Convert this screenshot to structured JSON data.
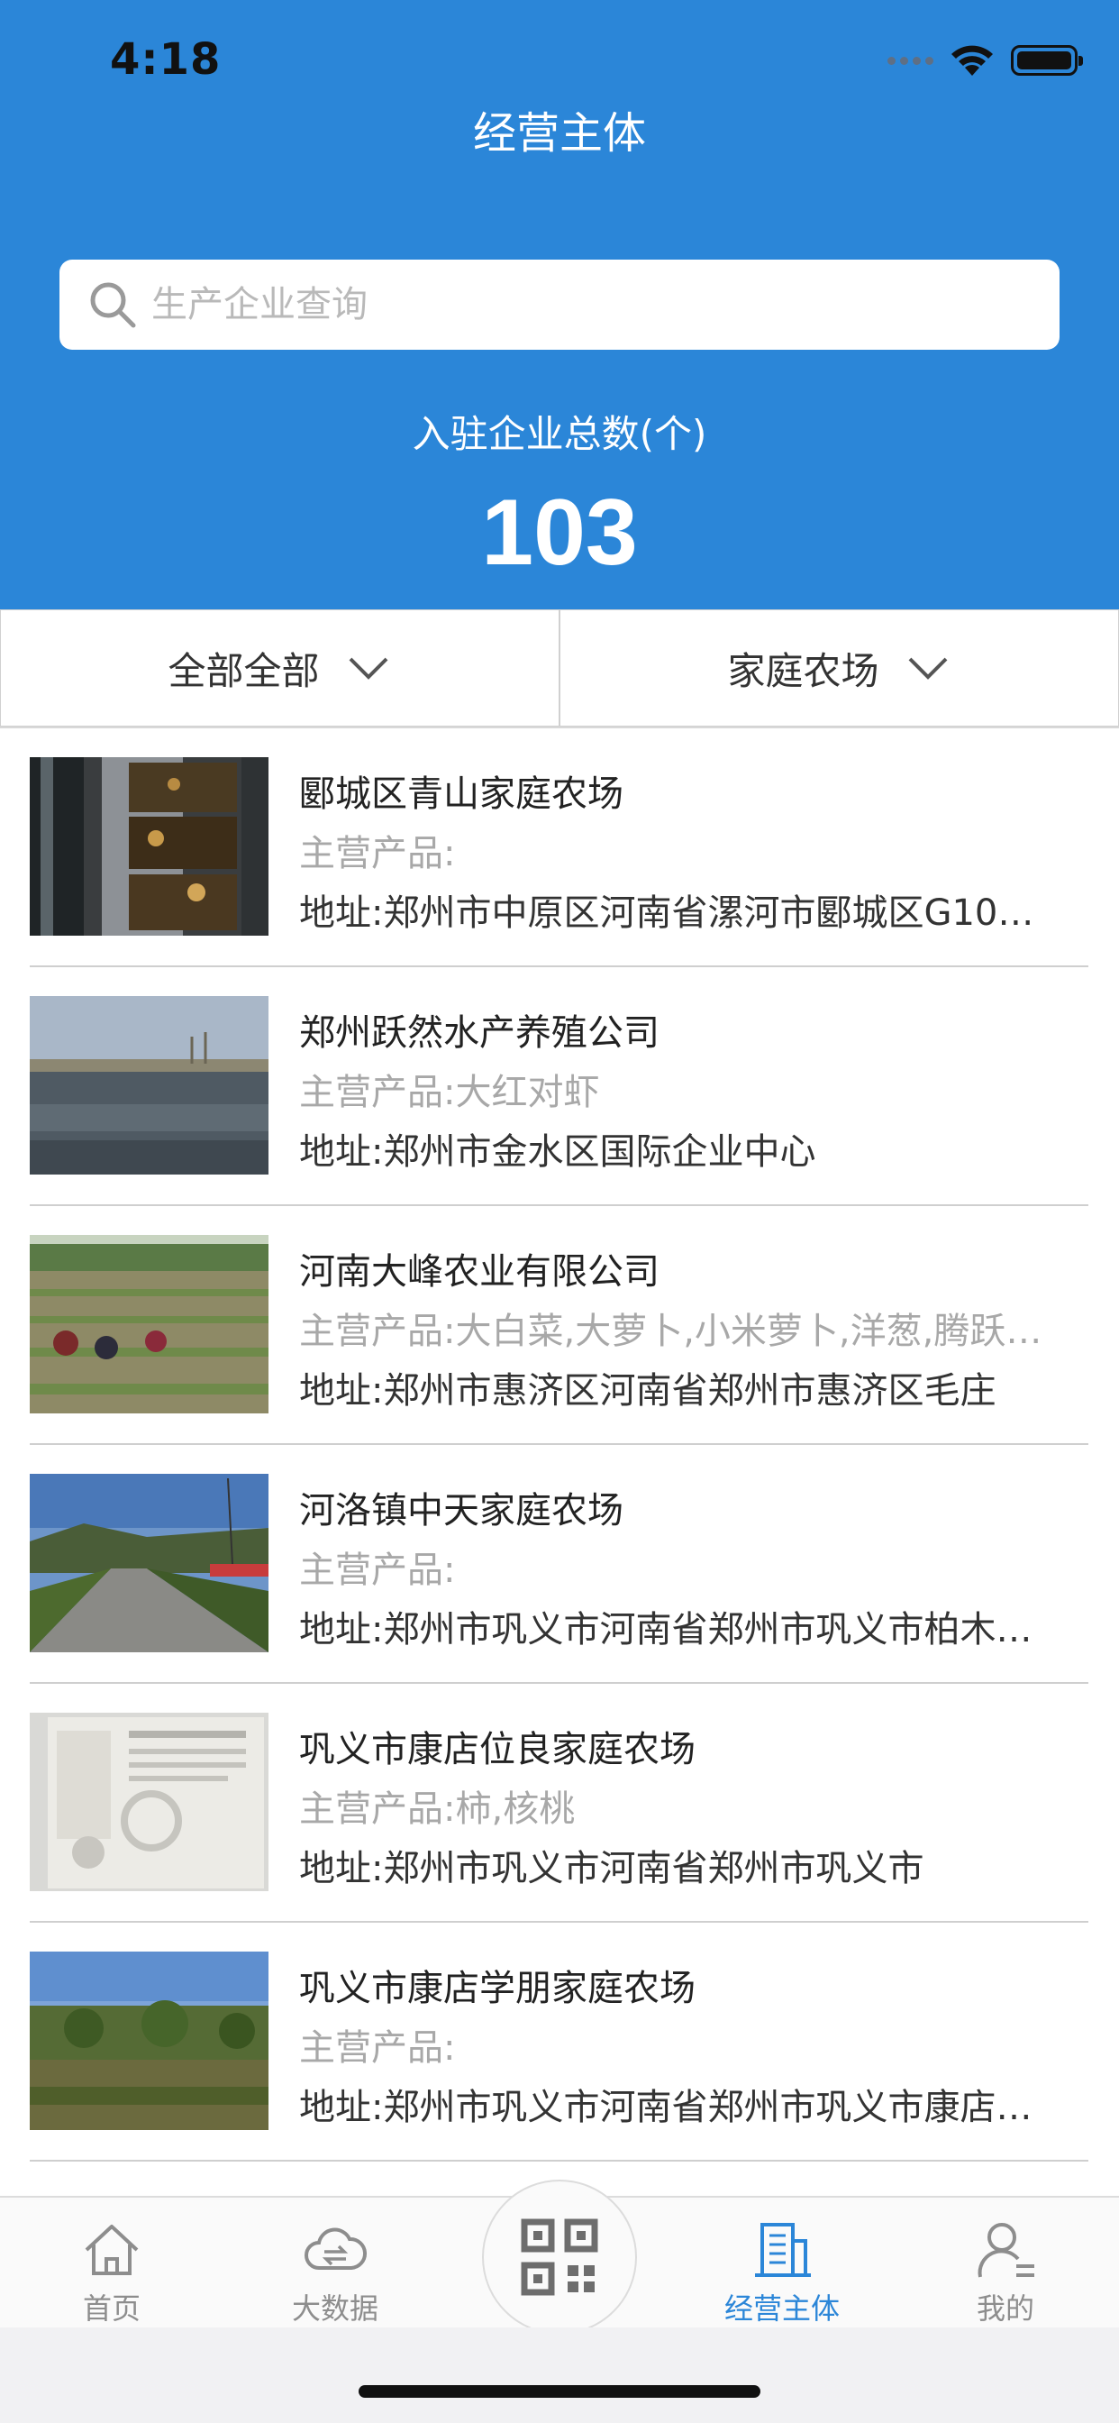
{
  "status_bar": {
    "time": "4:18"
  },
  "header": {
    "title": "经营主体",
    "search_placeholder": "生产企业查询",
    "count_label": "入驻企业总数(个)",
    "count_value": "103"
  },
  "filters": [
    {
      "label": "全部全部"
    },
    {
      "label": "家庭农场"
    }
  ],
  "list": [
    {
      "title": "郾城区青山家庭农场",
      "products": "主营产品:",
      "address": "地址:郑州市中原区河南省漯河市郾城区G10…"
    },
    {
      "title": "郑州跃然水产养殖公司",
      "products": "主营产品:大红对虾",
      "address": "地址:郑州市金水区国际企业中心"
    },
    {
      "title": "河南大峰农业有限公司",
      "products": "主营产品:大白菜,大萝卜,小米萝卜,洋葱,腾跃…",
      "address": "地址:郑州市惠济区河南省郑州市惠济区毛庄"
    },
    {
      "title": "河洛镇中天家庭农场",
      "products": "主营产品:",
      "address": "地址:郑州市巩义市河南省郑州市巩义市柏木…"
    },
    {
      "title": "巩义市康店位良家庭农场",
      "products": "主营产品:柿,核桃",
      "address": "地址:郑州市巩义市河南省郑州市巩义市"
    },
    {
      "title": "巩义市康店学朋家庭农场",
      "products": "主营产品:",
      "address": "地址:郑州市巩义市河南省郑州市巩义市康店…"
    }
  ],
  "tabbar": {
    "tabs": [
      {
        "label": "首页",
        "icon": "home-icon"
      },
      {
        "label": "大数据",
        "icon": "cloud-sync-icon"
      },
      {
        "label": "经营主体",
        "icon": "building-icon",
        "active": true
      },
      {
        "label": "我的",
        "icon": "user-icon"
      }
    ],
    "scan_icon": "qr-code-icon"
  },
  "colors": {
    "primary": "#2b86d8",
    "inactive": "#8d8d8d"
  }
}
